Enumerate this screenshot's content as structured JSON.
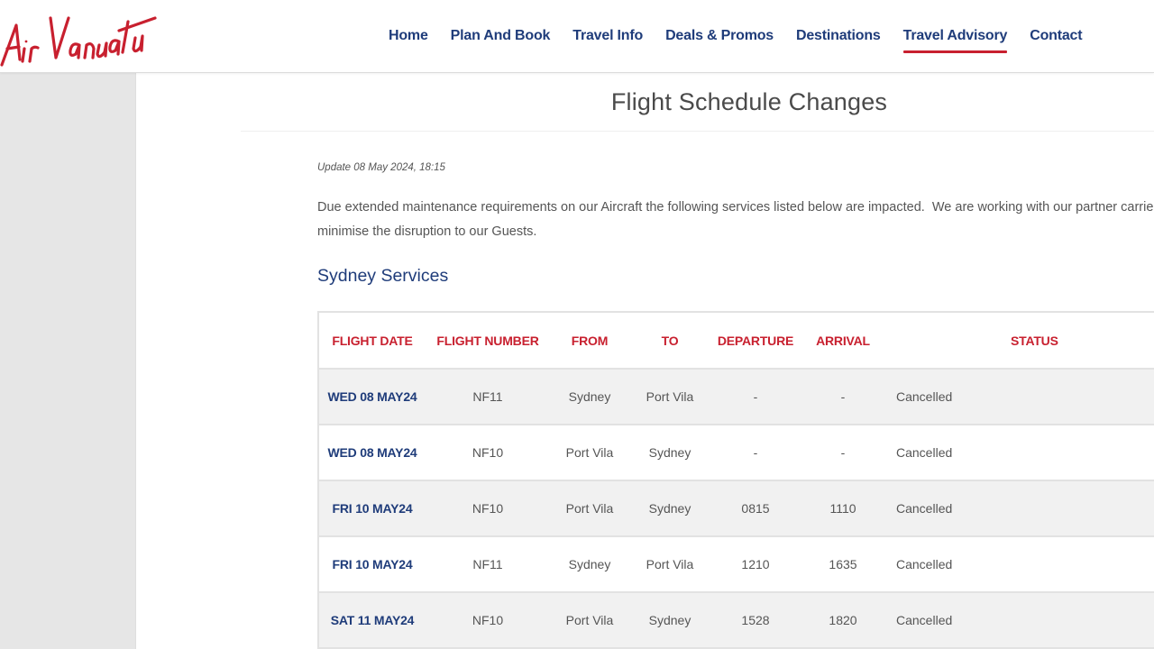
{
  "brand": {
    "logo_text": "AirVanuatu",
    "primary_color": "#1f3c7a",
    "accent_color": "#c8202f"
  },
  "nav": {
    "items": [
      {
        "label": "Home",
        "active": false
      },
      {
        "label": "Plan And Book",
        "active": false
      },
      {
        "label": "Travel Info",
        "active": false
      },
      {
        "label": "Deals & Promos",
        "active": false
      },
      {
        "label": "Destinations",
        "active": false
      },
      {
        "label": "Travel Advisory",
        "active": true
      },
      {
        "label": "Contact",
        "active": false
      }
    ]
  },
  "page": {
    "title": "Flight Schedule Changes",
    "update_note": "Update 08 May 2024, 18:15",
    "intro": "Due extended maintenance requirements on our Aircraft the following services listed below are impacted.  We are working with our partner carriers t minimise the disruption to our Guests.",
    "intro_line1": "Due extended maintenance requirements on our Aircraft the following services listed below are impacted.  We are working with our partner carriers t",
    "intro_line2": "minimise the disruption to our Guests.",
    "section_title": "Sydney Services"
  },
  "table": {
    "headers": [
      "FLIGHT DATE",
      "FLIGHT NUMBER",
      "FROM",
      "TO",
      "DEPARTURE",
      "ARRIVAL",
      "STATUS"
    ],
    "rows": [
      {
        "date": "WED 08 MAY24",
        "flight": "NF11",
        "from": "Sydney",
        "to": "Port Vila",
        "departure": "-",
        "arrival": "-",
        "status": "Cancelled"
      },
      {
        "date": "WED 08 MAY24",
        "flight": "NF10",
        "from": "Port Vila",
        "to": "Sydney",
        "departure": "-",
        "arrival": "-",
        "status": "Cancelled"
      },
      {
        "date": "FRI 10 MAY24",
        "flight": "NF10",
        "from": "Port Vila",
        "to": "Sydney",
        "departure": "0815",
        "arrival": "1110",
        "status": "Cancelled"
      },
      {
        "date": "FRI 10 MAY24",
        "flight": "NF11",
        "from": "Sydney",
        "to": "Port Vila",
        "departure": "1210",
        "arrival": "1635",
        "status": "Cancelled"
      },
      {
        "date": "SAT 11 MAY24",
        "flight": "NF10",
        "from": "Port Vila",
        "to": "Sydney",
        "departure": "1528",
        "arrival": "1820",
        "status": "Cancelled"
      }
    ]
  }
}
